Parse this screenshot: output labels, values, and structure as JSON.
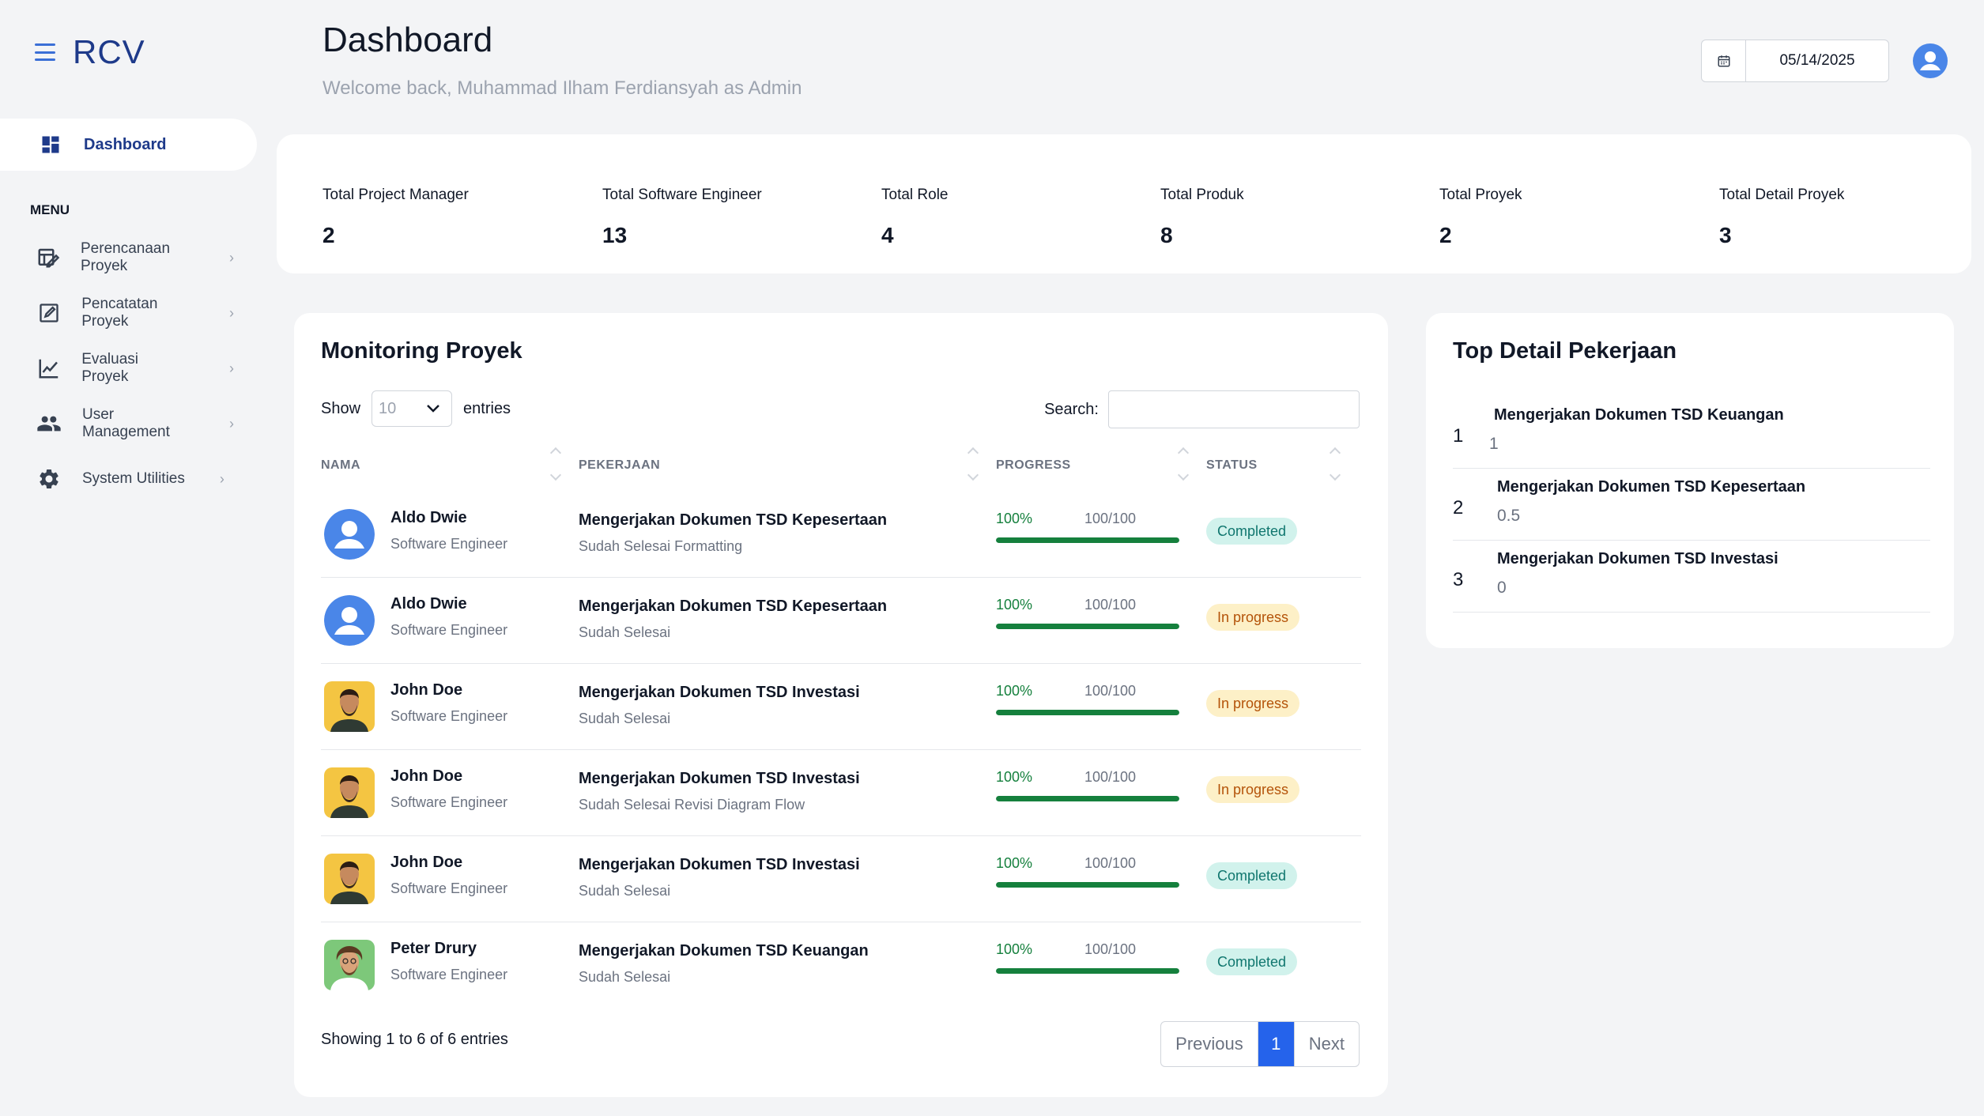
{
  "app": {
    "brand": "RCV",
    "colors": {
      "primary": "#1e3a8a",
      "accent": "#2563eb",
      "success": "#15803d"
    }
  },
  "sidebar": {
    "active_item": {
      "label": "Dashboard",
      "icon": "dashboard-icon"
    },
    "menu_heading": "MENU",
    "items": [
      {
        "label": "Perencanaan Proyek",
        "icon": "planning-icon"
      },
      {
        "label": "Pencatatan Proyek",
        "icon": "edit-note-icon"
      },
      {
        "label": "Evaluasi Proyek",
        "icon": "line-chart-icon"
      },
      {
        "label": "User Management",
        "icon": "users-icon"
      },
      {
        "label": "System Utilities",
        "icon": "gear-icon"
      }
    ]
  },
  "header": {
    "title": "Dashboard",
    "subtitle": "Welcome back, Muhammad Ilham Ferdiansyah as Admin",
    "date_value": "05/14/2025"
  },
  "stats": [
    {
      "label": "Total Project Manager",
      "value": "2"
    },
    {
      "label": "Total Software Engineer",
      "value": "13"
    },
    {
      "label": "Total Role",
      "value": "4"
    },
    {
      "label": "Total Produk",
      "value": "8"
    },
    {
      "label": "Total Proyek",
      "value": "2"
    },
    {
      "label": "Total Detail Proyek",
      "value": "3"
    }
  ],
  "monitoring": {
    "title": "Monitoring Proyek",
    "show_label": "Show",
    "entries_value": "10",
    "entries_label": "entries",
    "search_label": "Search:",
    "columns": [
      "NAMA",
      "PEKERJAAN",
      "PROGRESS",
      "STATUS"
    ],
    "rows": [
      {
        "name": "Aldo Dwie",
        "role": "Software Engineer",
        "job": "Mengerjakan Dokumen TSD Kepesertaan",
        "note": "Sudah Selesai Formatting",
        "pct": "100%",
        "score": "100/100",
        "progress": 1.0,
        "status": "Completed",
        "status_kind": "done",
        "avatar": "default-avatar"
      },
      {
        "name": "Aldo Dwie",
        "role": "Software Engineer",
        "job": "Mengerjakan Dokumen TSD Kepesertaan",
        "note": "Sudah Selesai",
        "pct": "100%",
        "score": "100/100",
        "progress": 1.0,
        "status": "In progress",
        "status_kind": "prog",
        "avatar": "default-avatar"
      },
      {
        "name": "John Doe",
        "role": "Software Engineer",
        "job": "Mengerjakan Dokumen TSD Investasi",
        "note": "Sudah Selesai",
        "pct": "100%",
        "score": "100/100",
        "progress": 1.0,
        "status": "In progress",
        "status_kind": "prog",
        "avatar": "photo-john"
      },
      {
        "name": "John Doe",
        "role": "Software Engineer",
        "job": "Mengerjakan Dokumen TSD Investasi",
        "note": "Sudah Selesai Revisi Diagram Flow",
        "pct": "100%",
        "score": "100/100",
        "progress": 1.0,
        "status": "In progress",
        "status_kind": "prog",
        "avatar": "photo-john"
      },
      {
        "name": "John Doe",
        "role": "Software Engineer",
        "job": "Mengerjakan Dokumen TSD Investasi",
        "note": "Sudah Selesai",
        "pct": "100%",
        "score": "100/100",
        "progress": 1.0,
        "status": "Completed",
        "status_kind": "done",
        "avatar": "photo-john"
      },
      {
        "name": "Peter Drury",
        "role": "Software Engineer",
        "job": "Mengerjakan Dokumen TSD Keuangan",
        "note": "Sudah Selesai",
        "pct": "100%",
        "score": "100/100",
        "progress": 1.0,
        "status": "Completed",
        "status_kind": "done",
        "avatar": "photo-peter"
      }
    ],
    "showing_text": "Showing 1 to 6 of 6 entries",
    "pagination": {
      "previous": "Previous",
      "current": "1",
      "next": "Next"
    }
  },
  "top_detail": {
    "title": "Top Detail Pekerjaan",
    "items": [
      {
        "rank": "1",
        "title": "Mengerjakan Dokumen TSD Keuangan",
        "value": "1"
      },
      {
        "rank": "2",
        "title": "Mengerjakan Dokumen TSD Kepesertaan",
        "value": "0.5"
      },
      {
        "rank": "3",
        "title": "Mengerjakan Dokumen TSD Investasi",
        "value": "0"
      }
    ]
  }
}
